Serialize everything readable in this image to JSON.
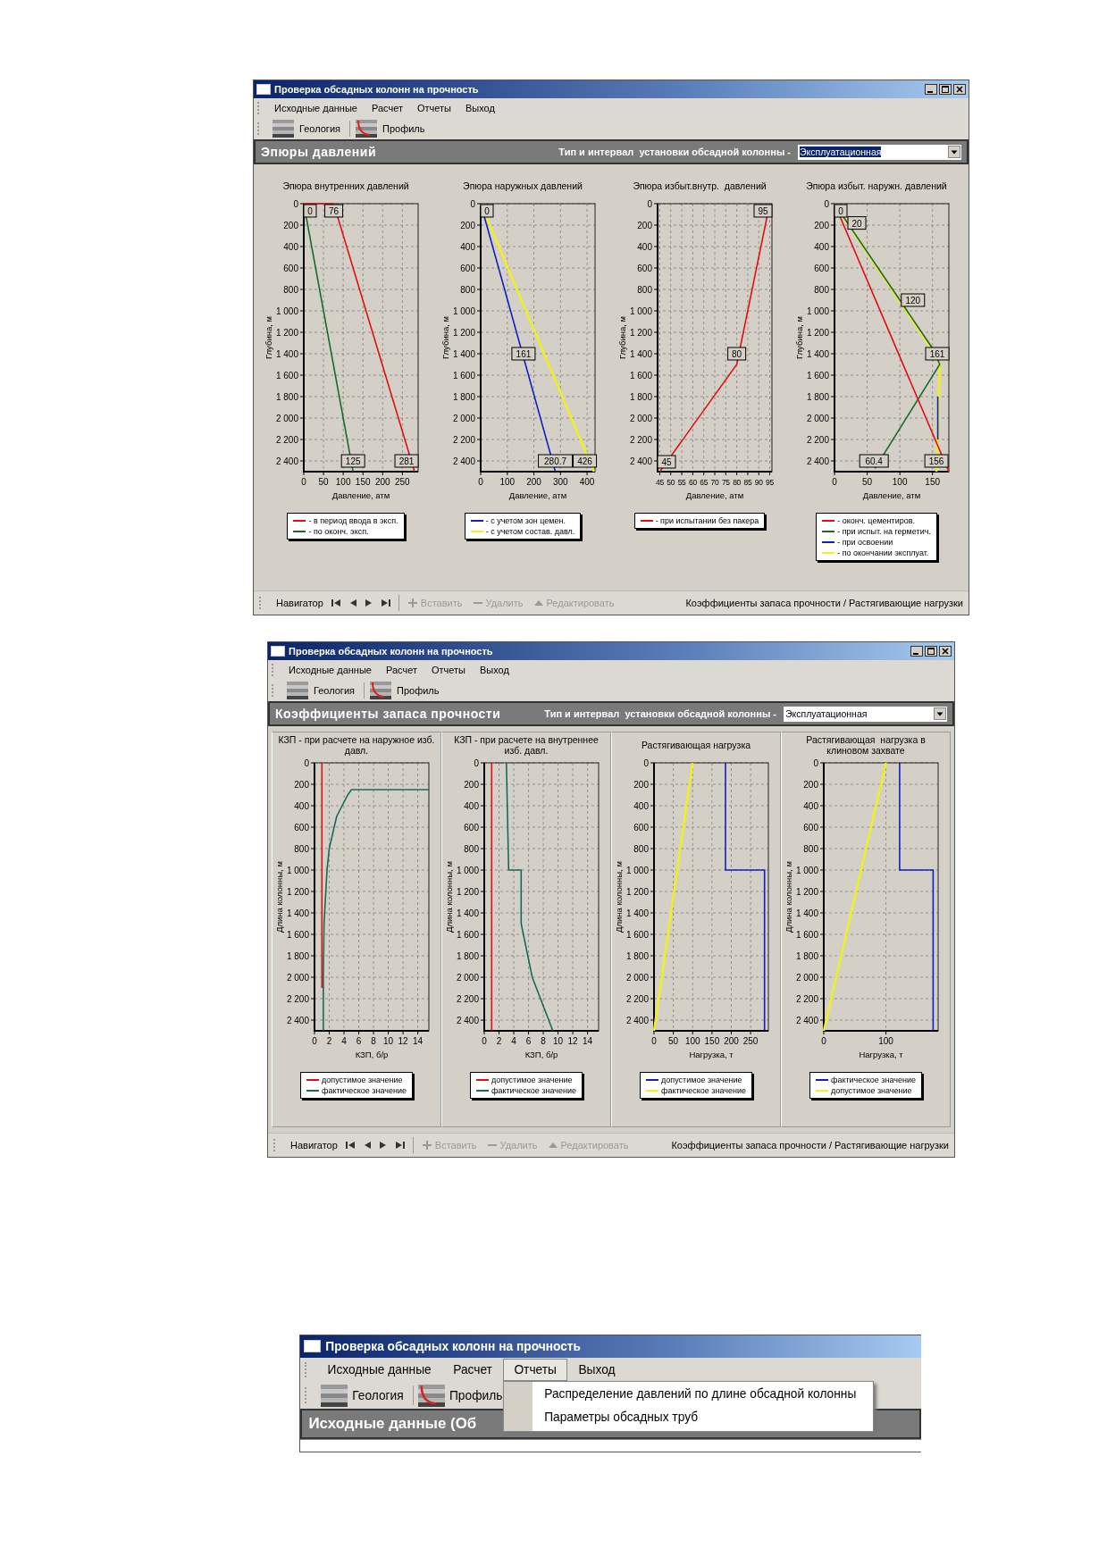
{
  "windows": [
    {
      "title": "Проверка обсадных колонн на прочность",
      "controls": true,
      "menu": [
        {
          "label": "Исходные данные",
          "selected": false
        },
        {
          "label": "Расчет",
          "selected": false
        },
        {
          "label": "Отчеты",
          "selected": false
        },
        {
          "label": "Выход",
          "selected": false
        }
      ],
      "toolbar": [
        {
          "label": "Геология",
          "kind": "geology"
        },
        {
          "label": "Профиль",
          "kind": "profile"
        }
      ],
      "header": {
        "title": "Эпюры давлений",
        "type_label": "Тип и интервал  установки обсадной колонны -",
        "combo": {
          "value": "Эксплуатационная",
          "highlighted": true
        }
      },
      "framed": false,
      "charts": [
        {
          "chart_data": {
            "type": "line",
            "grid": true,
            "legend": "bottom",
            "title": "Эпюра внутренних давлений",
            "xlabel": "Давление, атм",
            "ylabel": "Глубина, м",
            "xlim": [
              0,
              290
            ],
            "ylim": [
              2500,
              0
            ],
            "xticks": [
              0,
              50,
              100,
              150,
              200,
              250
            ],
            "yticks": [
              0,
              200,
              400,
              600,
              800,
              {
                "value": 1000,
                "label": "1 000"
              },
              {
                "value": 1200,
                "label": "1 200"
              },
              {
                "value": 1400,
                "label": "1 400"
              },
              {
                "value": 1600,
                "label": "1 600"
              },
              {
                "value": 1800,
                "label": "1 800"
              },
              {
                "value": 2000,
                "label": "2 000"
              },
              {
                "value": 2200,
                "label": "2 200"
              },
              {
                "value": 2400,
                "label": "2 400"
              }
            ],
            "series": [
              {
                "name": "- в период ввода в эксп.",
                "color": "#e01010",
                "x": [
                  0,
                  76,
                  281
                ],
                "values": [
                  0,
                  0,
                  2500
                ]
              },
              {
                "name": "- по оконч. эксп.",
                "color": "#1a6a2a",
                "x": [
                  0,
                  125
                ],
                "values": [
                  0,
                  2500
                ]
              }
            ],
            "annotations": [
              {
                "x": 0,
                "y": 0,
                "text": "0"
              },
              {
                "x": 76,
                "y": 0,
                "text": "76"
              },
              {
                "x": 125,
                "y": 2400,
                "text": "125"
              },
              {
                "x": 281,
                "y": 2400,
                "text": "281"
              }
            ]
          }
        },
        {
          "chart_data": {
            "type": "line",
            "grid": true,
            "legend": "bottom",
            "title": "Эпюра наружных давлений",
            "xlabel": "Давление, атм",
            "ylabel": "Глубина, м",
            "xlim": [
              0,
              430
            ],
            "ylim": [
              2500,
              0
            ],
            "xticks": [
              0,
              100,
              200,
              300,
              400
            ],
            "yticks": [
              0,
              200,
              400,
              600,
              800,
              {
                "value": 1000,
                "label": "1 000"
              },
              {
                "value": 1200,
                "label": "1 200"
              },
              {
                "value": 1400,
                "label": "1 400"
              },
              {
                "value": 1600,
                "label": "1 600"
              },
              {
                "value": 1800,
                "label": "1 800"
              },
              {
                "value": 2000,
                "label": "2 000"
              },
              {
                "value": 2200,
                "label": "2 200"
              },
              {
                "value": 2400,
                "label": "2 400"
              }
            ],
            "series": [
              {
                "name": "- с учетом зон цемен.",
                "color": "#1020c0",
                "x": [
                  0,
                  280.7
                ],
                "values": [
                  0,
                  2500
                ]
              },
              {
                "name": "- с учетом состав. давл.",
                "color": "#f0f020",
                "x": [
                  0,
                  426
                ],
                "values": [
                  0,
                  2500
                ]
              }
            ],
            "annotations": [
              {
                "x": 0,
                "y": 0,
                "text": "0"
              },
              {
                "x": 161,
                "y": 1400,
                "text": "161"
              },
              {
                "x": 280.7,
                "y": 2400,
                "text": "280.7"
              },
              {
                "x": 426,
                "y": 2400,
                "text": "426"
              }
            ]
          }
        },
        {
          "chart_data": {
            "type": "line",
            "grid": true,
            "legend": "bottom",
            "title": "Эпюра избыт.внутр.  давлений",
            "xlabel": "Давление, атм",
            "ylabel": "Глубина, м",
            "xlim": [
              44,
              96
            ],
            "ylim": [
              2500,
              0
            ],
            "xticks": [
              45,
              50,
              55,
              60,
              65,
              70,
              75,
              80,
              85,
              90,
              95
            ],
            "yticks": [
              0,
              200,
              400,
              600,
              800,
              {
                "value": 1000,
                "label": "1 000"
              },
              {
                "value": 1200,
                "label": "1 200"
              },
              {
                "value": 1400,
                "label": "1 400"
              },
              {
                "value": 1600,
                "label": "1 600"
              },
              {
                "value": 1800,
                "label": "1 800"
              },
              {
                "value": 2000,
                "label": "2 000"
              },
              {
                "value": 2200,
                "label": "2 200"
              },
              {
                "value": 2400,
                "label": "2 400"
              }
            ],
            "series": [
              {
                "name": "- при испытании без пакера",
                "color": "#e01010",
                "x": [
                  95,
                  80,
                  45
                ],
                "values": [
                  0,
                  1500,
                  2500
                ]
              }
            ],
            "annotations": [
              {
                "x": 95,
                "y": 0,
                "text": "95"
              },
              {
                "x": 80,
                "y": 1400,
                "text": "80"
              },
              {
                "x": 45,
                "y": 2500,
                "text": "45"
              }
            ]
          }
        },
        {
          "chart_data": {
            "type": "line",
            "grid": true,
            "legend": "bottom",
            "title": "Эпюра избыт. наружн. давлений",
            "xlabel": "Давление, атм",
            "ylabel": "Глубина, м",
            "xlim": [
              0,
              175
            ],
            "ylim": [
              2500,
              0
            ],
            "xticks": [
              0,
              50,
              100,
              150
            ],
            "yticks": [
              0,
              200,
              400,
              600,
              800,
              {
                "value": 1000,
                "label": "1 000"
              },
              {
                "value": 1200,
                "label": "1 200"
              },
              {
                "value": 1400,
                "label": "1 400"
              },
              {
                "value": 1600,
                "label": "1 600"
              },
              {
                "value": 1800,
                "label": "1 800"
              },
              {
                "value": 2000,
                "label": "2 000"
              },
              {
                "value": 2200,
                "label": "2 200"
              },
              {
                "value": 2400,
                "label": "2 400"
              }
            ],
            "series": [
              {
                "name": "- оконч. цементиров.",
                "color": "#e01010",
                "x": [
                  0,
                  175
                ],
                "values": [
                  0,
                  2500
                ]
              },
              {
                "name": "- при испыт. на герметич.",
                "color": "#1a6a2a",
                "x": [
                  0,
                  150,
                  161,
                  62
                ],
                "values": [
                  0,
                  1350,
                  1500,
                  2470
                ]
              },
              {
                "name": "- при освоении",
                "color": "#1020c0",
                "x": [
                  158,
                  158
                ],
                "values": [
                  1800,
                  2200
                ]
              },
              {
                "name": "- по окончании эксплуат.",
                "color": "#f0f020",
                "x": [
                  0,
                  148,
                  161,
                  156
                ],
                "values": [
                  0,
                  1350,
                  1500,
                  2500
                ]
              }
            ],
            "annotations": [
              {
                "x": 0,
                "y": 0,
                "text": "0"
              },
              {
                "x": 20,
                "y": 180,
                "text": "20"
              },
              {
                "x": 120,
                "y": 900,
                "text": "120"
              },
              {
                "x": 161,
                "y": 1400,
                "text": "161"
              },
              {
                "x": 60.4,
                "y": 2400,
                "text": "60.4"
              },
              {
                "x": 156,
                "y": 2400,
                "text": "156"
              }
            ]
          }
        }
      ],
      "navigator": {
        "label": "Навигатор",
        "actions": [
          {
            "label": "Вставить",
            "kind": "add",
            "disabled": true
          },
          {
            "label": "Удалить",
            "kind": "delete",
            "disabled": true
          },
          {
            "label": "Редактировать",
            "kind": "edit",
            "disabled": true
          }
        ],
        "link": "Коэффициенты запаса прочности / Растягивающие нагрузки"
      }
    },
    {
      "title": "Проверка обсадных колонн на прочность",
      "controls": true,
      "menu": [
        {
          "label": "Исходные данные",
          "selected": false
        },
        {
          "label": "Расчет",
          "selected": false
        },
        {
          "label": "Отчеты",
          "selected": false
        },
        {
          "label": "Выход",
          "selected": false
        }
      ],
      "toolbar": [
        {
          "label": "Геология",
          "kind": "geology"
        },
        {
          "label": "Профиль",
          "kind": "profile"
        }
      ],
      "header": {
        "title": "Коэффициенты запаса прочности",
        "type_label": "Тип и интервал  установки обсадной колонны -",
        "combo": {
          "value": "Эксплуатационная",
          "highlighted": false
        }
      },
      "framed": true,
      "charts": [
        {
          "chart_data": {
            "type": "line",
            "grid": true,
            "legend": "bottom",
            "title": "КЗП - при расчете на наружное изб. давл.",
            "xlabel": "КЗП, б/р",
            "ylabel": "Длина колонны, м",
            "xlim": [
              0,
              15.5
            ],
            "ylim": [
              2500,
              0
            ],
            "xticks": [
              0,
              2,
              4,
              6,
              8,
              10,
              12,
              14
            ],
            "yticks": [
              0,
              200,
              400,
              600,
              800,
              {
                "value": 1000,
                "label": "1 000"
              },
              {
                "value": 1200,
                "label": "1 200"
              },
              {
                "value": 1400,
                "label": "1 400"
              },
              {
                "value": 1600,
                "label": "1 600"
              },
              {
                "value": 1800,
                "label": "1 800"
              },
              {
                "value": 2000,
                "label": "2 000"
              },
              {
                "value": 2200,
                "label": "2 200"
              },
              {
                "value": 2400,
                "label": "2 400"
              }
            ],
            "series": [
              {
                "name": "допустимое значение",
                "color": "#e01010",
                "x": [
                  1,
                  1
                ],
                "values": [
                  0,
                  2100
                ]
              },
              {
                "name": "фактическое значение",
                "color": "#1a6a5a",
                "x": [
                  15.5,
                  5,
                  4.5,
                  3,
                  2,
                  1.7,
                  1.3,
                  1.2,
                  1.2
                ],
                "values": [
                  250,
                  250,
                  300,
                  500,
                  800,
                  1000,
                  1500,
                  2000,
                  2500
                ]
              }
            ]
          }
        },
        {
          "chart_data": {
            "type": "line",
            "grid": true,
            "legend": "bottom",
            "title": "КЗП - при расчете на внутреннее изб. давл.",
            "xlabel": "КЗП, б/р",
            "ylabel": "Длина колонны, м",
            "xlim": [
              0,
              15.5
            ],
            "ylim": [
              2500,
              0
            ],
            "xticks": [
              0,
              2,
              4,
              6,
              8,
              10,
              12,
              14
            ],
            "yticks": [
              0,
              200,
              400,
              600,
              800,
              {
                "value": 1000,
                "label": "1 000"
              },
              {
                "value": 1200,
                "label": "1 200"
              },
              {
                "value": 1400,
                "label": "1 400"
              },
              {
                "value": 1600,
                "label": "1 600"
              },
              {
                "value": 1800,
                "label": "1 800"
              },
              {
                "value": 2000,
                "label": "2 000"
              },
              {
                "value": 2200,
                "label": "2 200"
              },
              {
                "value": 2400,
                "label": "2 400"
              }
            ],
            "series": [
              {
                "name": "допустимое значение",
                "color": "#e01010",
                "x": [
                  1,
                  1
                ],
                "values": [
                  0,
                  2500
                ]
              },
              {
                "name": "фактическое значение",
                "color": "#1a6a5a",
                "x": [
                  3,
                  3.3,
                  5,
                  5,
                  6.5,
                  9.3
                ],
                "values": [
                  0,
                  1000,
                  1000,
                  1500,
                  2000,
                  2500
                ]
              }
            ]
          }
        },
        {
          "chart_data": {
            "type": "line",
            "grid": true,
            "legend": "bottom",
            "title": "Растягивающая нагрузка",
            "xlabel": "Нагрузка, т",
            "ylabel": "Длина колонны, м",
            "xlim": [
              0,
              296
            ],
            "ylim": [
              2500,
              0
            ],
            "xticks": [
              0,
              50,
              100,
              150,
              200,
              250
            ],
            "yticks": [
              0,
              200,
              400,
              600,
              800,
              {
                "value": 1000,
                "label": "1 000"
              },
              {
                "value": 1200,
                "label": "1 200"
              },
              {
                "value": 1400,
                "label": "1 400"
              },
              {
                "value": 1600,
                "label": "1 600"
              },
              {
                "value": 1800,
                "label": "1 800"
              },
              {
                "value": 2000,
                "label": "2 000"
              },
              {
                "value": 2200,
                "label": "2 200"
              },
              {
                "value": 2400,
                "label": "2 400"
              }
            ],
            "series": [
              {
                "name": "допустимое значение",
                "color": "#1020c0",
                "x": [
                  185,
                  185,
                  286,
                  286
                ],
                "values": [
                  0,
                  1000,
                  1000,
                  2500
                ]
              },
              {
                "name": "фактическое значение",
                "color": "#f0f020",
                "x": [
                  100,
                  0
                ],
                "values": [
                  0,
                  2500
                ]
              }
            ]
          }
        },
        {
          "chart_data": {
            "type": "line",
            "grid": true,
            "legend": "bottom",
            "title": "Растягивающая  нагрузка в клиновом захвате",
            "xlabel": "Нагрузка, т",
            "ylabel": "Длина колонны, м",
            "xlim": [
              0,
              184
            ],
            "ylim": [
              2500,
              0
            ],
            "xticks": [
              0,
              100
            ],
            "yticks": [
              0,
              200,
              400,
              600,
              800,
              {
                "value": 1000,
                "label": "1 000"
              },
              {
                "value": 1200,
                "label": "1 200"
              },
              {
                "value": 1400,
                "label": "1 400"
              },
              {
                "value": 1600,
                "label": "1 600"
              },
              {
                "value": 1800,
                "label": "1 800"
              },
              {
                "value": 2000,
                "label": "2 000"
              },
              {
                "value": 2200,
                "label": "2 200"
              },
              {
                "value": 2400,
                "label": "2 400"
              }
            ],
            "series": [
              {
                "name": "фактическое значение",
                "color": "#1020c0",
                "x": [
                  122,
                  122,
                  176,
                  176
                ],
                "values": [
                  0,
                  1000,
                  1000,
                  2500
                ]
              },
              {
                "name": "допустимое значение",
                "color": "#f0f020",
                "x": [
                  100,
                  0
                ],
                "values": [
                  0,
                  2500
                ]
              }
            ]
          }
        }
      ],
      "navigator": {
        "label": "Навигатор",
        "actions": [
          {
            "label": "Вставить",
            "kind": "add",
            "disabled": true
          },
          {
            "label": "Удалить",
            "kind": "delete",
            "disabled": true
          },
          {
            "label": "Редактировать",
            "kind": "edit",
            "disabled": true
          }
        ],
        "link": "Коэффициенты запаса прочности / Растягивающие нагрузки"
      }
    },
    {
      "title": "Проверка обсадных колонн на прочность",
      "controls": false,
      "menu": [
        {
          "label": "Исходные данные",
          "selected": false
        },
        {
          "label": "Расчет",
          "selected": false
        },
        {
          "label": "Отчеты",
          "selected": true,
          "dropdown": [
            "Распределение давлений по длине обсадной колонны",
            "Параметры обсадных труб"
          ]
        },
        {
          "label": "Выход",
          "selected": false
        }
      ],
      "toolbar": [
        {
          "label": "Геология",
          "kind": "geology"
        },
        {
          "label": "Профиль",
          "kind": "profile"
        }
      ],
      "header": {
        "title": "Исходные данные (Об"
      }
    }
  ]
}
